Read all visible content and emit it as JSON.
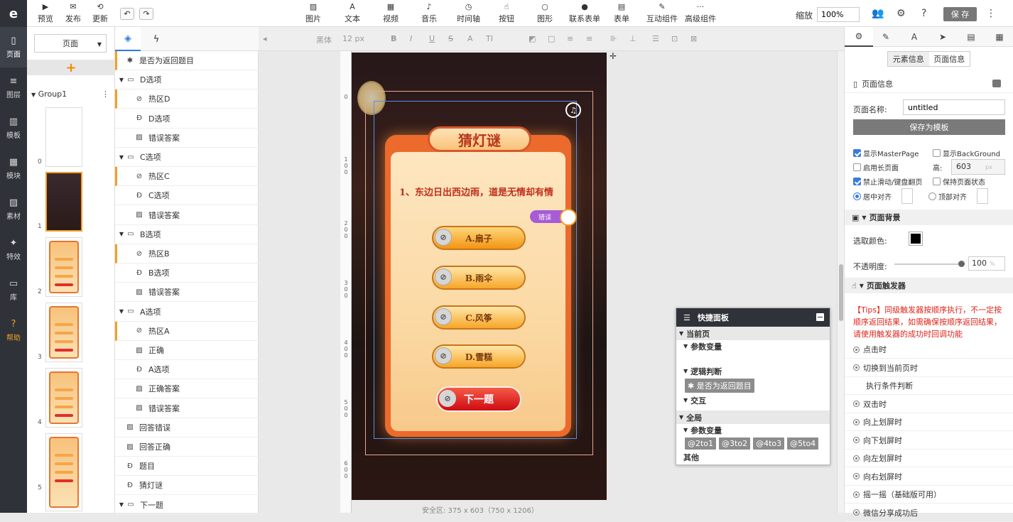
{
  "rail": {
    "logo": "e",
    "items": [
      {
        "label": "页面",
        "icon": "page-icon"
      },
      {
        "label": "图层",
        "icon": "layers-icon"
      },
      {
        "label": "模板",
        "icon": "template-icon"
      },
      {
        "label": "模块",
        "icon": "module-icon"
      },
      {
        "label": "素材",
        "icon": "image-icon"
      },
      {
        "label": "特效",
        "icon": "effect-icon"
      },
      {
        "label": "库",
        "icon": "library-icon"
      },
      {
        "label": "帮助",
        "icon": "help-icon"
      }
    ]
  },
  "toolbar": {
    "left": [
      {
        "label": "预览",
        "icon": "preview-icon"
      },
      {
        "label": "发布",
        "icon": "publish-icon"
      },
      {
        "label": "更新",
        "icon": "update-icon"
      }
    ],
    "center": [
      {
        "label": "图片",
        "icon": "image-icon"
      },
      {
        "label": "文本",
        "icon": "text-icon"
      },
      {
        "label": "视频",
        "icon": "video-icon"
      },
      {
        "label": "音乐",
        "icon": "music-icon"
      },
      {
        "label": "时间轴",
        "icon": "timeline-icon"
      },
      {
        "label": "按钮",
        "icon": "button-icon"
      },
      {
        "label": "图形",
        "icon": "shape-icon"
      },
      {
        "label": "联系表单",
        "icon": "contact-form-icon"
      },
      {
        "label": "表单",
        "icon": "form-icon"
      },
      {
        "label": "互动组件",
        "icon": "interactive-icon"
      },
      {
        "label": "高级组件",
        "icon": "more-icon"
      }
    ],
    "zoom_label": "缩放",
    "zoom_value": "100%",
    "save_label": "保 存"
  },
  "pages": {
    "selector": "页面",
    "group": "Group1",
    "thumbs": [
      "0",
      "1",
      "2",
      "3",
      "4",
      "5"
    ]
  },
  "layers": {
    "rows": [
      {
        "label": "是否为返回题目",
        "icon": "star-icon",
        "indent": 1,
        "hot": true,
        "arrow": false
      },
      {
        "label": "D选项",
        "icon": "folder-icon",
        "indent": 0,
        "hot": false,
        "arrow": true
      },
      {
        "label": "热区D",
        "icon": "link-icon",
        "indent": 2,
        "hot": true,
        "arrow": false
      },
      {
        "label": "D选项",
        "icon": "text-icon",
        "indent": 2,
        "hot": false,
        "arrow": false
      },
      {
        "label": "错误答案",
        "icon": "image-icon",
        "indent": 2,
        "hot": false,
        "arrow": false
      },
      {
        "label": "C选项",
        "icon": "folder-icon",
        "indent": 0,
        "hot": false,
        "arrow": true
      },
      {
        "label": "热区C",
        "icon": "link-icon",
        "indent": 2,
        "hot": true,
        "arrow": false
      },
      {
        "label": "C选项",
        "icon": "text-icon",
        "indent": 2,
        "hot": false,
        "arrow": false
      },
      {
        "label": "错误答案",
        "icon": "image-icon",
        "indent": 2,
        "hot": false,
        "arrow": false
      },
      {
        "label": "B选项",
        "icon": "folder-icon",
        "indent": 0,
        "hot": false,
        "arrow": true
      },
      {
        "label": "热区B",
        "icon": "link-icon",
        "indent": 2,
        "hot": true,
        "arrow": false
      },
      {
        "label": "B选项",
        "icon": "text-icon",
        "indent": 2,
        "hot": false,
        "arrow": false
      },
      {
        "label": "错误答案",
        "icon": "image-icon",
        "indent": 2,
        "hot": false,
        "arrow": false
      },
      {
        "label": "A选项",
        "icon": "folder-icon",
        "indent": 0,
        "hot": false,
        "arrow": true
      },
      {
        "label": "热区A",
        "icon": "link-icon",
        "indent": 2,
        "hot": true,
        "arrow": false
      },
      {
        "label": "正确",
        "icon": "image-icon",
        "indent": 2,
        "hot": false,
        "arrow": false
      },
      {
        "label": "A选项",
        "icon": "text-icon",
        "indent": 2,
        "hot": false,
        "arrow": false
      },
      {
        "label": "正确答案",
        "icon": "image-icon",
        "indent": 2,
        "hot": false,
        "arrow": false
      },
      {
        "label": "错误答案",
        "icon": "image-icon",
        "indent": 2,
        "hot": false,
        "arrow": false
      },
      {
        "label": "回答错误",
        "icon": "image-icon",
        "indent": 1,
        "hot": false,
        "arrow": false
      },
      {
        "label": "回答正确",
        "icon": "image-icon",
        "indent": 1,
        "hot": false,
        "arrow": false
      },
      {
        "label": "题目",
        "icon": "text-icon",
        "indent": 1,
        "hot": false,
        "arrow": false
      },
      {
        "label": "猜灯谜",
        "icon": "text-icon",
        "indent": 1,
        "hot": false,
        "arrow": false
      },
      {
        "label": "下一题",
        "icon": "folder-icon",
        "indent": 0,
        "hot": false,
        "arrow": true
      }
    ]
  },
  "format_bar": {
    "font": "黑体",
    "size": "12 px"
  },
  "canvas": {
    "ruler_marks": [
      "0",
      "1 0 0",
      "2 0 0",
      "3 0 0",
      "4 0 0",
      "5 0 0",
      "6 0 0"
    ],
    "title": "猜灯谜",
    "question": "1、东边日出西边雨，道是无情却有情",
    "options": [
      "A.扇子",
      "B.雨伞",
      "C.风筝",
      "D.雪糕"
    ],
    "next": "下一题",
    "wrong_tag": "错误",
    "safe_area": "安全区: 375 x 603（750 x 1206）",
    "accent": "#ec6a2c"
  },
  "quick": {
    "title": "快捷面板",
    "current_page": "当前页",
    "params": "参数变量",
    "logic": "逻辑判断",
    "logic_chip": "✱ 是否为返回题目",
    "interaction": "交互",
    "global": "全局",
    "global_params": "参数变量",
    "chips": [
      "@2to1",
      "@3to2",
      "@4to3",
      "@5to4"
    ],
    "more": "其他"
  },
  "props": {
    "seg": [
      "元素信息",
      "页面信息"
    ],
    "page_info": "页面信息",
    "name_label": "页面名称:",
    "name_value": "untitled",
    "save_template": "保存为模板",
    "show_master": "显示MasterPage",
    "show_bg": "显示BackGround",
    "long_page": "启用长页面",
    "height_label": "高:",
    "height_value": "603",
    "height_unit": "px",
    "no_swipe": "禁止滑动/键盘翻页",
    "keep_state": "保持页面状态",
    "center_align": "居中对齐",
    "top_align": "顶部对齐",
    "bg_section": "页面背景",
    "color_label": "选取颜色:",
    "opacity_label": "不透明度:",
    "opacity_value": "100",
    "opacity_unit": "%",
    "trigger_section": "页面触发器",
    "tips": "【Tips】同级触发器按顺序执行，不一定按顺序返回结果，如需确保按顺序返回结果，请使用触发器的成功时回调功能",
    "triggers": [
      "点击时",
      "切换到当前页时",
      "执行条件判断",
      "双击时",
      "向上划屏时",
      "向下划屏时",
      "向左划屏时",
      "向右划屏时",
      "摇一摇（基础版可用）",
      "微信分享成功后"
    ]
  }
}
